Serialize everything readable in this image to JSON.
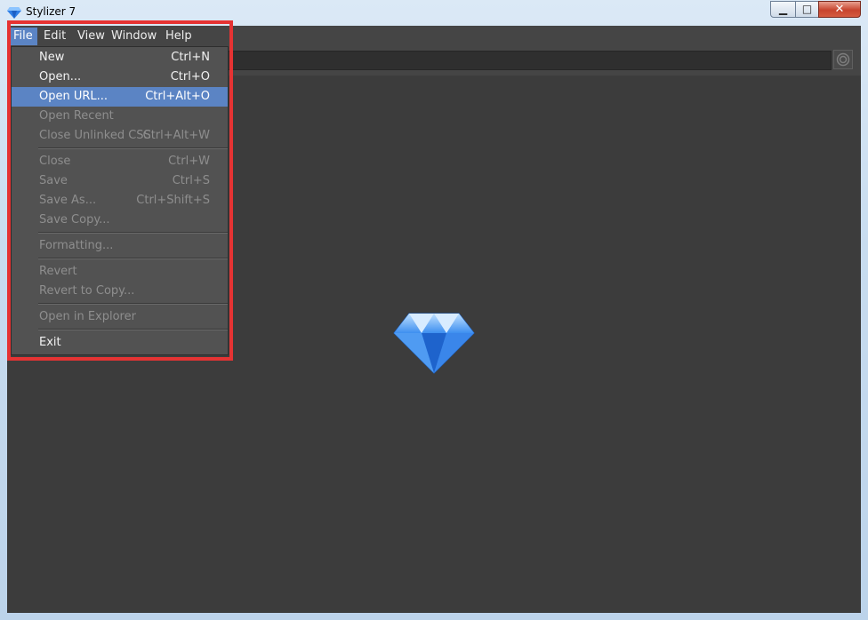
{
  "window": {
    "title": "Stylizer 7",
    "minimize_glyph": "▁",
    "maximize_glyph": "□",
    "close_glyph": "✕"
  },
  "menubar": {
    "items": [
      {
        "label": "File",
        "active": true
      },
      {
        "label": "Edit"
      },
      {
        "label": "View"
      },
      {
        "label": "Window"
      },
      {
        "label": "Help"
      }
    ]
  },
  "file_menu": {
    "items": [
      {
        "label": "New",
        "shortcut": "Ctrl+N",
        "enabled": true
      },
      {
        "label": "Open...",
        "shortcut": "Ctrl+O",
        "enabled": true
      },
      {
        "label": "Open URL...",
        "shortcut": "Ctrl+Alt+O",
        "enabled": true,
        "highlighted": true
      },
      {
        "label": "Open Recent",
        "shortcut": "",
        "enabled": false
      },
      {
        "label": "Close Unlinked CSS",
        "shortcut": "Ctrl+Alt+W",
        "enabled": false
      },
      {
        "label": "Close",
        "shortcut": "Ctrl+W",
        "enabled": false
      },
      {
        "label": "Save",
        "shortcut": "Ctrl+S",
        "enabled": false
      },
      {
        "label": "Save As...",
        "shortcut": "Ctrl+Shift+S",
        "enabled": false
      },
      {
        "label": "Save Copy...",
        "shortcut": "",
        "enabled": false
      },
      {
        "label": "Formatting...",
        "shortcut": "",
        "enabled": false
      },
      {
        "label": "Revert",
        "shortcut": "",
        "enabled": false
      },
      {
        "label": "Revert to Copy...",
        "shortcut": "",
        "enabled": false
      },
      {
        "label": "Open in Explorer",
        "shortcut": "",
        "enabled": false
      },
      {
        "label": "Exit",
        "shortcut": "",
        "enabled": true
      }
    ]
  },
  "colors": {
    "highlight": "#5b84c4",
    "annotation": "#e53333",
    "diamond": "#2f7fe6"
  },
  "icons": {
    "app": "diamond-icon",
    "toolbar_right": "target-icon",
    "center_logo": "diamond-logo"
  }
}
